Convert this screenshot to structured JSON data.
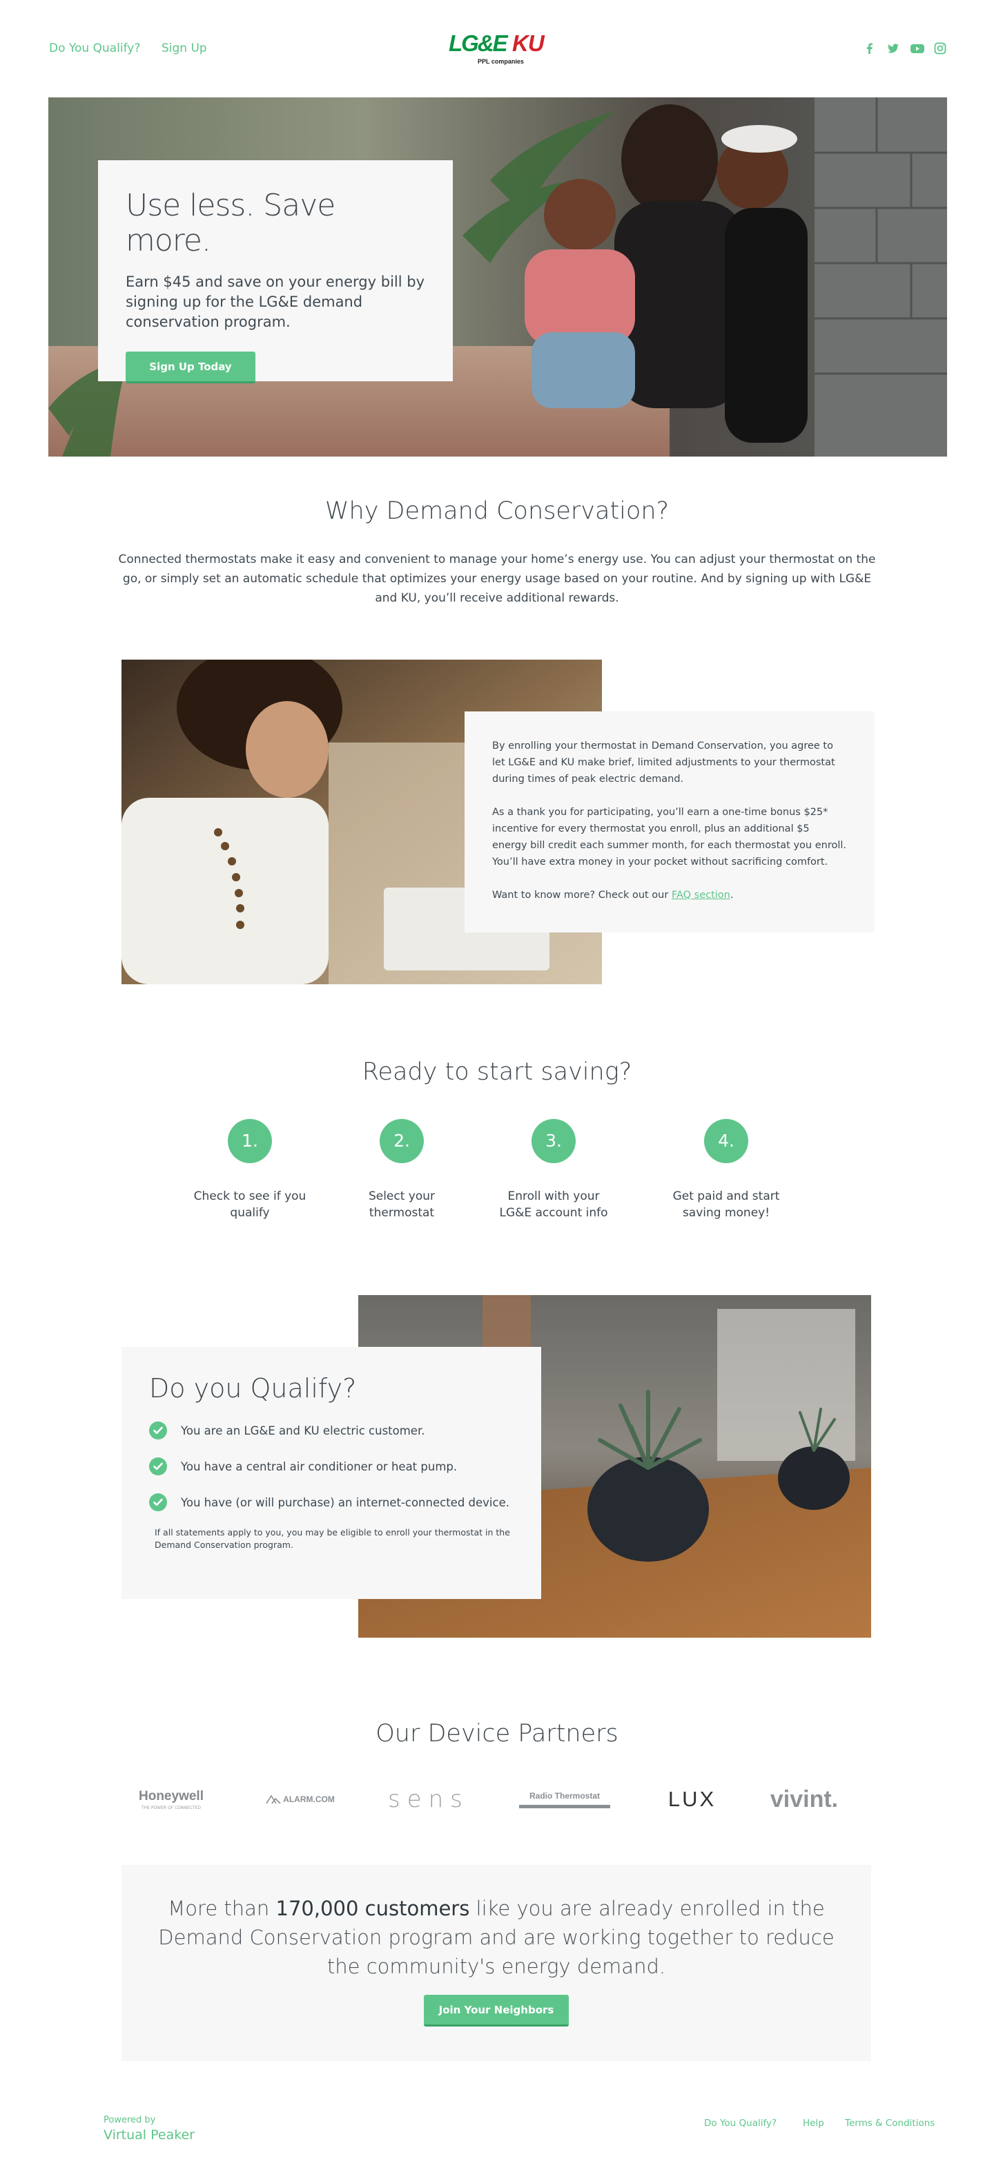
{
  "header": {
    "nav": [
      "Do You Qualify?",
      "Sign Up"
    ],
    "logo_text_lge": "LG&E",
    "logo_text_ku": "KU",
    "logo_sub": "PPL companies",
    "social_icons": [
      "facebook-icon",
      "twitter-icon",
      "youtube-icon",
      "instagram-icon"
    ]
  },
  "hero": {
    "title": "Use less. Save more.",
    "body": "Earn $45 and save on your energy bill by signing up for the LG&E demand conservation program.",
    "button": "Sign Up Today"
  },
  "why": {
    "title": "Why Demand Conservation?",
    "body": "Connected thermostats make it easy and convenient to manage your home’s energy use. You can adjust your thermostat on the go, or simply set an automatic schedule that optimizes your energy usage based on your routine. And by signing up with LG&E and KU, you’ll receive additional rewards."
  },
  "info": {
    "p1": "By enrolling your thermostat in Demand Conservation, you agree to let LG&E and KU make brief, limited adjustments to your thermostat during times of peak electric demand.",
    "p2": "As a thank you for participating, you’ll earn a one-time bonus $25* incentive for every thermostat you enroll, plus an additional $5 energy bill credit each summer month, for each thermostat you enroll. You’ll have extra money in your pocket without sacrificing comfort.",
    "p3_prefix": "Want to know more? Check out our ",
    "p3_link": "FAQ section",
    "p3_suffix": "."
  },
  "ready": {
    "title": "Ready to start saving?",
    "steps": [
      {
        "num": "1.",
        "text": "Check to see if you qualify"
      },
      {
        "num": "2.",
        "text": "Select your thermostat"
      },
      {
        "num": "3.",
        "text": "Enroll with your LG&E account info"
      },
      {
        "num": "4.",
        "text": "Get paid and start saving money!"
      }
    ]
  },
  "qualify": {
    "title": "Do you Qualify?",
    "items": [
      "You are an LG&E and KU electric customer.",
      "You have a central air conditioner or heat pump.",
      "You have (or will purchase) an internet-connected device."
    ],
    "note": "If all statements apply to you, you may be eligible to enroll your thermostat in the Demand Conservation program."
  },
  "partners": {
    "title": "Our Device Partners",
    "logos": [
      "Honeywell",
      "ALARM.COM",
      "sensi",
      "Radio Thermostat",
      "LUX",
      "vivint."
    ],
    "honeywell_sub": "THE POWER OF CONNECTED"
  },
  "neighbors": {
    "text_prefix": "More than ",
    "text_bold": "170,000 customers",
    "text_suffix": " like you are already enrolled in the Demand Conservation program and are working together to reduce the community's energy demand.",
    "button": "Join Your Neighbors"
  },
  "footer": {
    "powered_by": "Powered by",
    "brand": "Virtual Peaker",
    "links": [
      "Do You Qualify?",
      "Help",
      "Terms & Conditions"
    ]
  },
  "colors": {
    "accent": "#5ec58a",
    "lge_green": "#0b9444",
    "ku_red": "#d2232a",
    "panel": "#f7f7f7"
  }
}
